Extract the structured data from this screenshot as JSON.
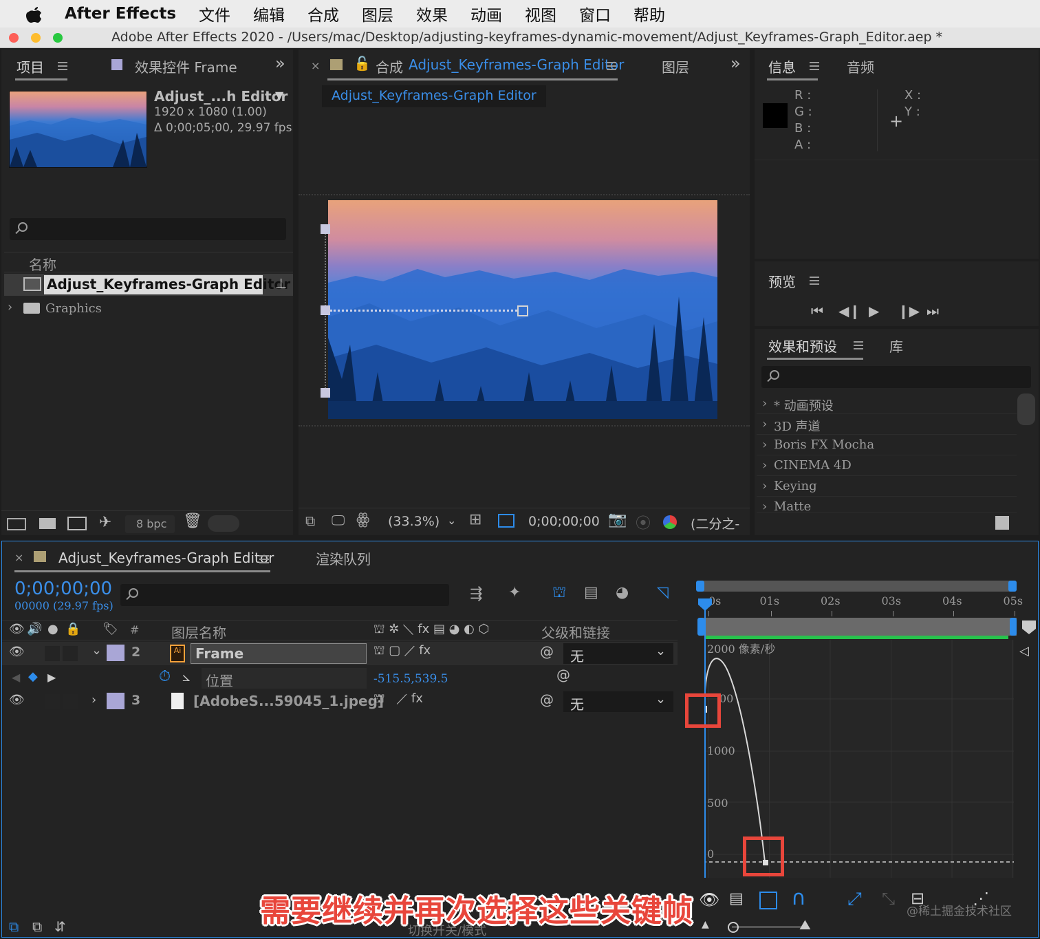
{
  "menubar": {
    "app_name": "After Effects",
    "items": [
      "文件",
      "编辑",
      "合成",
      "图层",
      "效果",
      "动画",
      "视图",
      "窗口",
      "帮助"
    ]
  },
  "window": {
    "title": "Adobe After Effects 2020 - /Users/mac/Desktop/adjusting-keyframes-dynamic-movement/Adjust_Keyframes-Graph_Editor.aep *"
  },
  "project_panel": {
    "tab_project": "项目",
    "tab_effect_controls": "效果控件 Frame",
    "comp_name": "Adjust_...h Editor",
    "comp_size": "1920 x 1080 (1.00)",
    "comp_duration": "Δ 0;00;05;00, 29.97 fps",
    "col_name": "名称",
    "items": [
      {
        "label": "Adjust_Keyframes-Graph Editor"
      },
      {
        "label": "Graphics"
      }
    ],
    "bpc": "8 bpc"
  },
  "comp_panel": {
    "tab_prefix": "合成",
    "tab_name": "Adjust_Keyframes-Graph Editor",
    "tab_layer": "图层",
    "breadcrumb": "Adjust_Keyframes-Graph Editor",
    "zoom": "(33.3%)",
    "timecode": "0;00;00;00",
    "resolution": "(二分之-"
  },
  "info_panel": {
    "tab_info": "信息",
    "tab_audio": "音频",
    "r": "R :",
    "g": "G :",
    "b": "B :",
    "a": "A :",
    "x": "X :",
    "y": "Y :"
  },
  "preview_panel": {
    "title": "预览"
  },
  "effects_panel": {
    "tab_effects": "效果和预设",
    "tab_library": "库",
    "items": [
      "* 动画预设",
      "3D 声道",
      "Boris FX Mocha",
      "CINEMA 4D",
      "Keying",
      "Matte"
    ]
  },
  "timeline": {
    "tab_comp": "Adjust_Keyframes-Graph Editor",
    "tab_render": "渲染队列",
    "timecode": "0;00;00;00",
    "frame_info": "00000 (29.97 fps)",
    "col_hash": "#",
    "col_layer_name": "图层名称",
    "col_parent": "父级和链接",
    "layers": [
      {
        "num": "2",
        "name": "Frame",
        "parent": "无"
      },
      {
        "num": "3",
        "name": "[AdobeS...59045_1.jpeg]",
        "parent": "无"
      }
    ],
    "property": {
      "name": "位置",
      "value": "-515.5,539.5"
    },
    "bottom_label": "切换开关/模式"
  },
  "graph_editor": {
    "ruler_labels": [
      "0s",
      "01s",
      "02s",
      "03s",
      "04s",
      "05s"
    ],
    "y_unit_label": "2000 像素/秒",
    "y_labels": [
      "00",
      "1000",
      "500",
      "0"
    ]
  },
  "overlay": {
    "caption": "需要继续并再次选择这些关键帧",
    "watermark": "@稀土掘金技术社区"
  },
  "colors": {
    "accent_blue": "#2d8ceb",
    "highlight_red": "#e8463b",
    "panel_bg": "#232323",
    "green_bar": "#27c24c"
  }
}
